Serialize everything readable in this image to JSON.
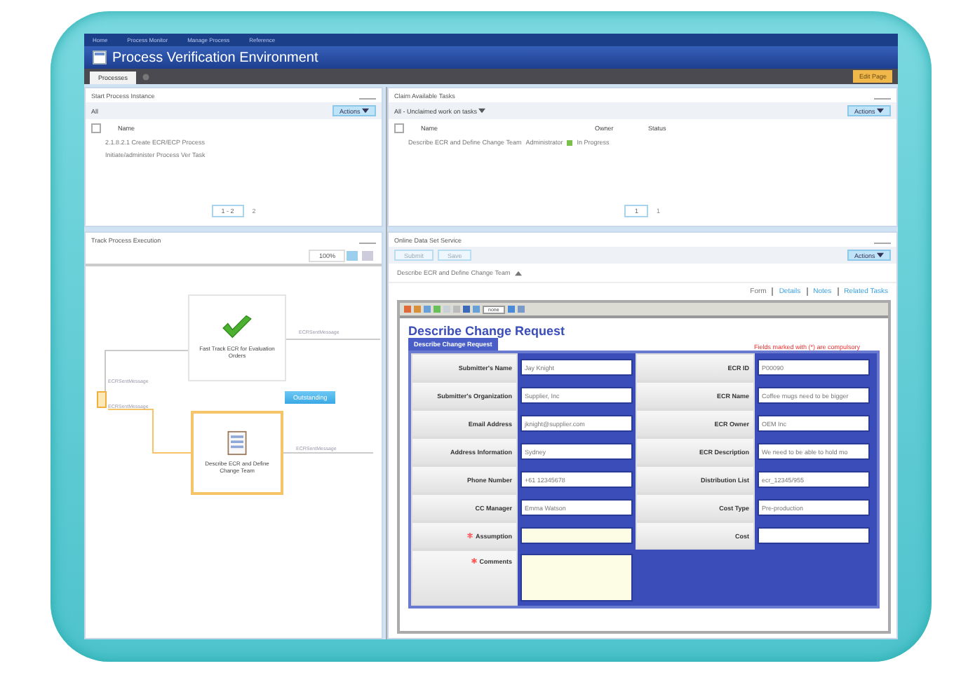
{
  "nav": {
    "items": [
      "Home",
      "Process Monitor",
      "Manage Process",
      "Reference"
    ]
  },
  "window": {
    "title": "Process Verification Environment"
  },
  "tabs": [
    {
      "label": "Processes",
      "selected": true
    }
  ],
  "edit_page_button": "Edit Page",
  "start_panel": {
    "title": "Start Process Instance",
    "filter": "All",
    "actions": "Actions",
    "select_all": {
      "checked": false
    },
    "columns": [
      "Name"
    ],
    "rows": [
      "2.1.8.2.1 Create ECR/ECP Process",
      "Initiate/administer Process Ver Task"
    ],
    "pager": {
      "range": "1 - 2",
      "total": "2"
    }
  },
  "claim_panel": {
    "title": "Claim Available Tasks",
    "filter": "All - Unclaimed work on tasks",
    "actions": "Actions",
    "select_all": {
      "checked": false
    },
    "columns": [
      "Name",
      "Owner",
      "Status"
    ],
    "rows": [
      {
        "name": "Describe ECR and Define Change Team",
        "owner": "Administrator",
        "status": "In Progress"
      }
    ],
    "pager": {
      "range": "1",
      "total": "1"
    }
  },
  "track_panel": {
    "title": "Track Process Execution",
    "zoom": "100%",
    "nodes": [
      {
        "label": "Fast Track ECR for Evaluation Orders",
        "kind": "done"
      },
      {
        "label": "Describe ECR and Define Change Team",
        "kind": "active"
      }
    ],
    "badge": "Outstanding",
    "messages": [
      "ECRSentMessage",
      "ECRSentMessage",
      "ECRSentMessage",
      "ECRSentMessage"
    ]
  },
  "task_panel": {
    "title": "Online Data Set Service",
    "buttons": [
      "Submit",
      "Save"
    ],
    "actions": "Actions",
    "task_title": "Describe ECR and Define Change Team",
    "links": [
      "Form",
      "Details",
      "Notes",
      "Related Tasks"
    ],
    "toolbar_select": "none",
    "form": {
      "title": "Describe Change Request",
      "section": "Describe Change Request",
      "notice": "Fields marked with (*) are compulsory",
      "rows": [
        {
          "left": {
            "label": "Submitter's Name",
            "value": "Jay Knight",
            "required": false,
            "kind": "text"
          },
          "right": {
            "label": "ECR ID",
            "value": "P00090",
            "required": false,
            "kind": "text"
          }
        },
        {
          "left": {
            "label": "Submitter's Organization",
            "value": "Supplier, Inc",
            "required": false,
            "kind": "text"
          },
          "right": {
            "label": "ECR Name",
            "value": "Coffee mugs need to be bigger",
            "required": false,
            "kind": "text"
          }
        },
        {
          "left": {
            "label": "Email Address",
            "value": "jknight@supplier.com",
            "required": false,
            "kind": "text"
          },
          "right": {
            "label": "ECR Owner",
            "value": "OEM Inc",
            "required": false,
            "kind": "text"
          }
        },
        {
          "left": {
            "label": "Address Information",
            "value": "Sydney",
            "required": false,
            "kind": "text"
          },
          "right": {
            "label": "ECR Description",
            "value": "We need to be able to hold mo",
            "required": false,
            "kind": "text"
          }
        },
        {
          "left": {
            "label": "Phone Number",
            "value": "+61 12345678",
            "required": false,
            "kind": "text"
          },
          "right": {
            "label": "Distribution List",
            "value": "ecr_12345/955",
            "required": false,
            "kind": "text"
          }
        },
        {
          "left": {
            "label": "CC Manager",
            "value": "Emma Watson",
            "required": false,
            "kind": "text"
          },
          "right": {
            "label": "Cost Type",
            "value": "Pre-production",
            "required": false,
            "kind": "text"
          }
        },
        {
          "left": {
            "label": "Assumption",
            "required": true,
            "kind": "text"
          },
          "right": {
            "label": "Cost",
            "required": false,
            "kind": "text"
          }
        },
        {
          "left": {
            "label": "Comments",
            "required": true,
            "kind": "textarea"
          }
        }
      ]
    }
  }
}
